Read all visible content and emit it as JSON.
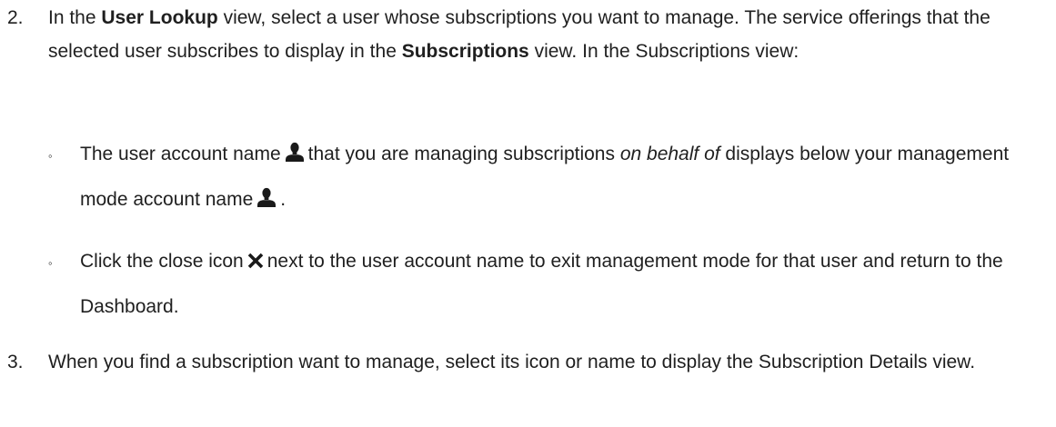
{
  "steps": [
    {
      "number": "2.",
      "segments": [
        "In the ",
        "User Lookup",
        " view, select a user whose subscriptions you want to manage. The service offerings that the selected user subscribes to display in the ",
        "Subscriptions",
        " view. In the Subscriptions view:"
      ],
      "bullets": [
        {
          "mark": "◦",
          "segments": [
            "The user account name",
            "that you are managing subscriptions ",
            "on behalf of",
            " displays below your management mode account name",
            "."
          ],
          "icons": [
            "user-icon",
            "user-icon"
          ]
        },
        {
          "mark": "◦",
          "segments": [
            "Click the close icon",
            "next to the user account name to exit management mode for that user and return to the Dashboard."
          ],
          "icons": [
            "close-icon"
          ]
        }
      ]
    },
    {
      "number": "3.",
      "segments": [
        "When you find a subscription want to manage, select its icon or name to display the Subscription Details view."
      ]
    }
  ],
  "colors": {
    "text": "#1f1f1f",
    "icon": "#1a1a1a"
  }
}
